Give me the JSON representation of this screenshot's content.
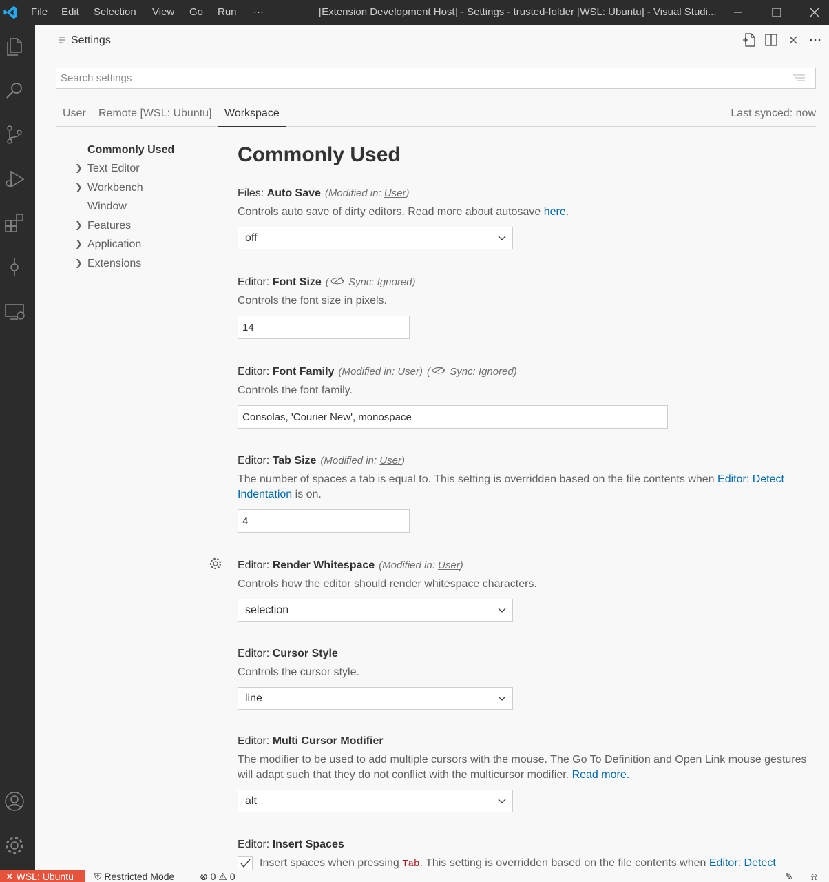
{
  "titlebar": {
    "menu": [
      "File",
      "Edit",
      "Selection",
      "View",
      "Go",
      "Run",
      "···"
    ],
    "title": "[Extension Development Host] - Settings - trusted-folder [WSL: Ubuntu] - Visual Studi..."
  },
  "editor": {
    "tab_title": "Settings"
  },
  "search": {
    "placeholder": "Search settings"
  },
  "scopes": {
    "user": "User",
    "remote": "Remote [WSL: Ubuntu]",
    "workspace": "Workspace",
    "synced": "Last synced: now"
  },
  "toc": [
    "Commonly Used",
    "Text Editor",
    "Workbench",
    "Window",
    "Features",
    "Application",
    "Extensions"
  ],
  "content": {
    "heading": "Commonly Used",
    "auto_save": {
      "category": "Files: ",
      "name": "Auto Save",
      "mod_prefix": "(Modified in: ",
      "mod_link": "User",
      "mod_suffix": ")",
      "desc": "Controls auto save of dirty editors. Read more about autosave ",
      "link": "here",
      "desc_end": ".",
      "value": "off"
    },
    "font_size": {
      "category": "Editor: ",
      "name": "Font Size",
      "sync": "Sync: Ignored",
      "desc": "Controls the font size in pixels.",
      "value": "14"
    },
    "font_family": {
      "category": "Editor: ",
      "name": "Font Family",
      "mod_prefix": "(Modified in: ",
      "mod_link": "User",
      "mod_suffix": ")",
      "sync": "Sync: Ignored",
      "desc": "Controls the font family.",
      "value": "Consolas, 'Courier New', monospace"
    },
    "tab_size": {
      "category": "Editor: ",
      "name": "Tab Size",
      "mod_prefix": "(Modified in: ",
      "mod_link": "User",
      "mod_suffix": ")",
      "desc": "The number of spaces a tab is equal to. This setting is overridden based on the file contents when ",
      "link": "Editor: Detect Indentation",
      "desc_end": " is on.",
      "value": "4"
    },
    "render_whitespace": {
      "category": "Editor: ",
      "name": "Render Whitespace",
      "mod_prefix": "(Modified in: ",
      "mod_link": "User",
      "mod_suffix": ")",
      "desc": "Controls how the editor should render whitespace characters.",
      "value": "selection"
    },
    "cursor_style": {
      "category": "Editor: ",
      "name": "Cursor Style",
      "desc": "Controls the cursor style.",
      "value": "line"
    },
    "multi_cursor": {
      "category": "Editor: ",
      "name": "Multi Cursor Modifier",
      "desc": "The modifier to be used to add multiple cursors with the mouse. The Go To Definition and Open Link mouse gestures will adapt such that they do not conflict with the multicursor modifier. ",
      "link": "Read more.",
      "value": "alt"
    },
    "insert_spaces": {
      "category": "Editor: ",
      "name": "Insert Spaces",
      "desc": "Insert spaces when pressing ",
      "code": "Tab",
      "desc_mid": ". This setting is overridden based on the file contents when ",
      "link": "Editor: Detect",
      "checked": true
    }
  },
  "statusbar": {
    "remote": "WSL: Ubuntu",
    "restricted": "Restricted Mode",
    "errors": "0",
    "warnings": "0"
  },
  "colors": {
    "accent": "#e5533c",
    "link": "#006ab1",
    "activity_bg": "#2c2c2c"
  }
}
